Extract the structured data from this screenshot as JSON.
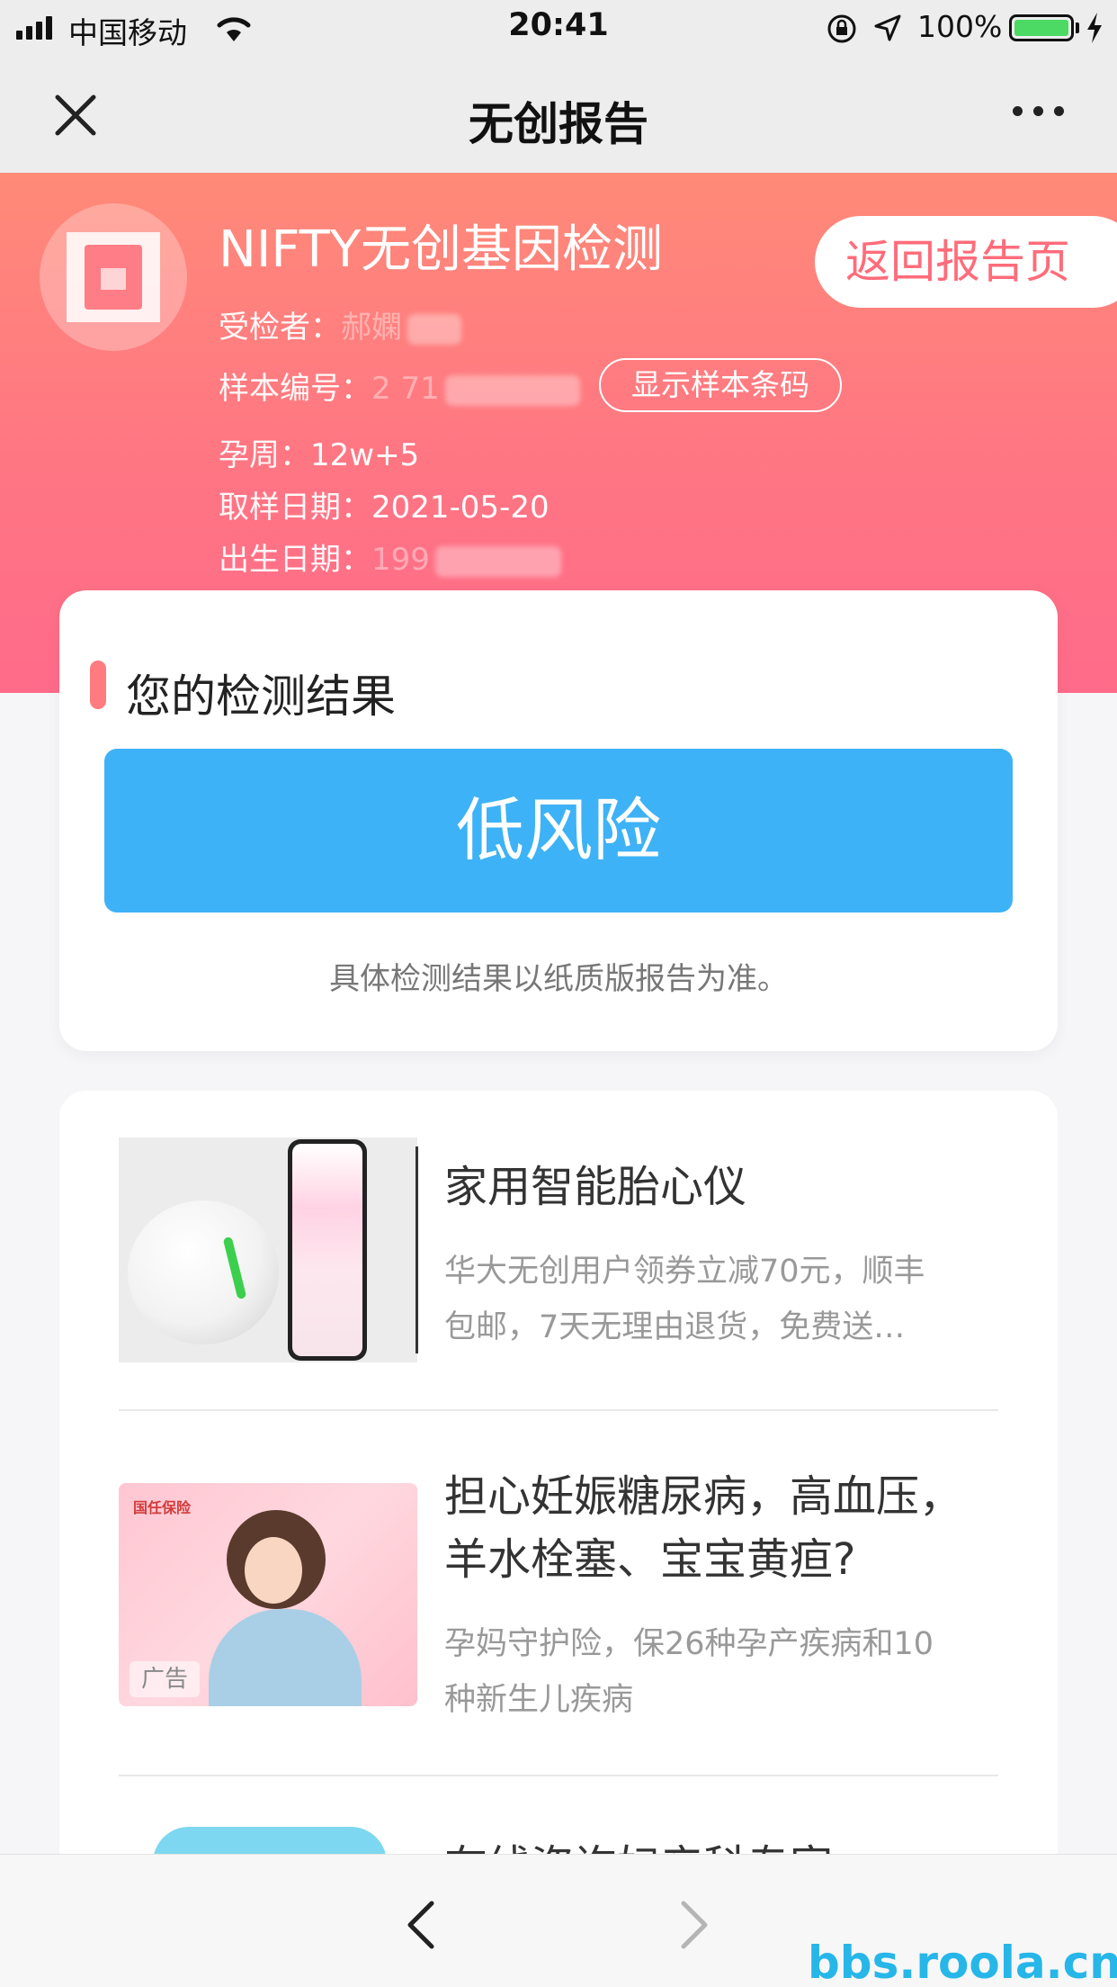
{
  "status_bar": {
    "carrier": "中国移动",
    "time": "20:41",
    "battery_percent": "100%",
    "battery_level": 1.0,
    "battery_color": "#4cd964"
  },
  "nav": {
    "title": "无创报告",
    "close_icon": "close-icon",
    "more_icon": "more-icon"
  },
  "header": {
    "report_title": "NIFTY无创基因检测",
    "return_button": "返回报告页",
    "examinee_label": "受检者：",
    "examinee_value": "郝嫻",
    "sample_label": "样本编号：",
    "sample_value": "2 71",
    "barcode_button": "显示样本条码",
    "gestation_label": "孕周：",
    "gestation_value": "12w+5",
    "sample_date_label": "取样日期：",
    "sample_date_value": "2021-05-20",
    "birth_label": "出生日期：",
    "birth_value": "199",
    "accent_color": "#ff7683"
  },
  "result": {
    "heading": "您的检测结果",
    "risk_level": "低风险",
    "note": "具体检测结果以纸质版报告为准。",
    "risk_color": "#3eb2f6"
  },
  "ads": [
    {
      "title": "家用智能胎心仪",
      "desc_line1": "华大无创用户领券立减70元，顺丰",
      "desc_line2": "包邮，7天无理由退货，免费送…"
    },
    {
      "title_line1": "担心妊娠糖尿病，高血压，",
      "title_line2": "羊水栓塞、宝宝黄疸?",
      "desc_line1": "孕妈守护险，保26种孕产疾病和10",
      "desc_line2": "种新生儿疾病",
      "image_brand": "国任保险",
      "image_tag": "广告"
    },
    {
      "title": "在线咨询妇产科专家"
    }
  ],
  "toolbar": {
    "back_icon": "chevron-left-icon",
    "forward_icon": "chevron-right-icon"
  },
  "watermark": "bbs.roola.cn"
}
